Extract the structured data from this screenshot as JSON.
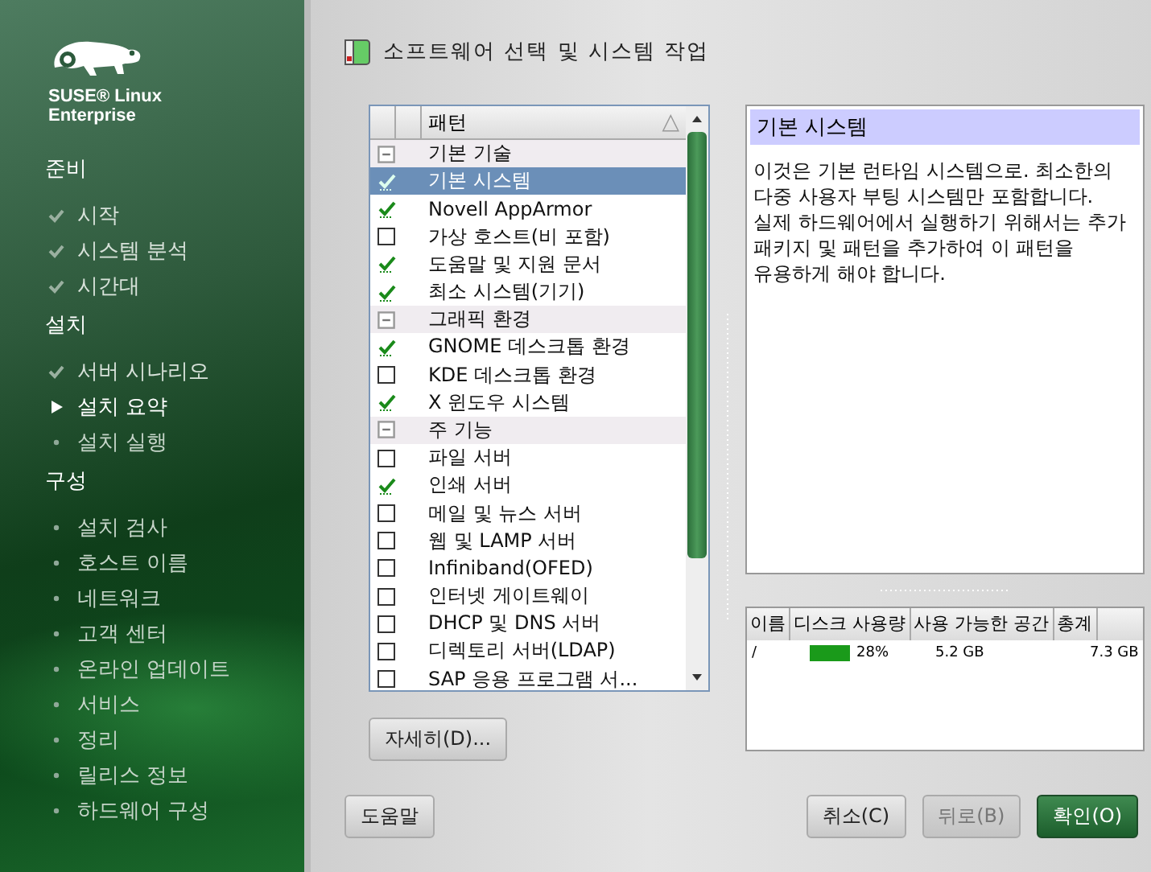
{
  "sidebar": {
    "logo_text": "SUSE® Linux Enterprise",
    "sections": [
      {
        "title": "준비",
        "items": [
          {
            "label": "시작",
            "kind": "done"
          },
          {
            "label": "시스템 분석",
            "kind": "done"
          },
          {
            "label": "시간대",
            "kind": "done"
          }
        ]
      },
      {
        "title": "설치",
        "items": [
          {
            "label": "서버 시나리오",
            "kind": "done"
          },
          {
            "label": "설치 요약",
            "kind": "current"
          },
          {
            "label": "설치 실행",
            "kind": "todo"
          }
        ]
      },
      {
        "title": "구성",
        "items": [
          {
            "label": "설치 검사",
            "kind": "todo"
          },
          {
            "label": "호스트 이름",
            "kind": "todo"
          },
          {
            "label": "네트워크",
            "kind": "todo"
          },
          {
            "label": "고객 센터",
            "kind": "todo"
          },
          {
            "label": "온라인 업데이트",
            "kind": "todo"
          },
          {
            "label": "서비스",
            "kind": "todo"
          },
          {
            "label": "정리",
            "kind": "todo"
          },
          {
            "label": "릴리스 정보",
            "kind": "todo"
          },
          {
            "label": "하드웨어 구성",
            "kind": "todo"
          }
        ]
      }
    ]
  },
  "title": "소프트웨어 선택 및 시스템 작업",
  "patterns": {
    "column": "패턴",
    "sort_glyph": "△",
    "rows": [
      {
        "kind": "group",
        "label": "기본 기술",
        "expanded": true
      },
      {
        "kind": "pattern",
        "label": "기본 시스템",
        "checked": true,
        "selected": true
      },
      {
        "kind": "pattern",
        "label": "Novell AppArmor",
        "checked": true,
        "selected": false
      },
      {
        "kind": "pattern",
        "label": "가상 호스트(비 포함)",
        "checked": false,
        "selected": false
      },
      {
        "kind": "pattern",
        "label": "도움말 및 지원 문서",
        "checked": true,
        "selected": false
      },
      {
        "kind": "pattern",
        "label": "최소 시스템(기기)",
        "checked": true,
        "selected": false
      },
      {
        "kind": "group",
        "label": "그래픽 환경",
        "expanded": true
      },
      {
        "kind": "pattern",
        "label": "GNOME 데스크톱 환경",
        "checked": true,
        "selected": false
      },
      {
        "kind": "pattern",
        "label": "KDE 데스크톱 환경",
        "checked": false,
        "selected": false
      },
      {
        "kind": "pattern",
        "label": "X 윈도우 시스템",
        "checked": true,
        "selected": false
      },
      {
        "kind": "group",
        "label": "주 기능",
        "expanded": true
      },
      {
        "kind": "pattern",
        "label": "파일 서버",
        "checked": false,
        "selected": false
      },
      {
        "kind": "pattern",
        "label": "인쇄 서버",
        "checked": true,
        "selected": false
      },
      {
        "kind": "pattern",
        "label": "메일 및 뉴스 서버",
        "checked": false,
        "selected": false
      },
      {
        "kind": "pattern",
        "label": "웹 및 LAMP 서버",
        "checked": false,
        "selected": false
      },
      {
        "kind": "pattern",
        "label": "Infiniband(OFED)",
        "checked": false,
        "selected": false
      },
      {
        "kind": "pattern",
        "label": "인터넷 게이트웨이",
        "checked": false,
        "selected": false
      },
      {
        "kind": "pattern",
        "label": "DHCP 및 DNS 서버",
        "checked": false,
        "selected": false
      },
      {
        "kind": "pattern",
        "label": "디렉토리 서버(LDAP)",
        "checked": false,
        "selected": false
      },
      {
        "kind": "pattern",
        "label": "SAP 응용 프로그램 서...",
        "checked": false,
        "selected": false
      }
    ]
  },
  "details_button": "자세히(D)...",
  "description": {
    "heading": "기본 시스템",
    "text": "이것은 기본 런타임 시스템으로. 최소한의 다중 사용자 부팅 시스템만 포함합니다. 실제 하드웨어에서 실행하기 위해서는 추가 패키지 및 패턴을 추가하여 이 패턴을 유용하게 해야 합니다."
  },
  "disk": {
    "columns": [
      "이름",
      "디스크 사용량",
      "사용 가능한 공간",
      "총계"
    ],
    "rows": [
      {
        "name": "/",
        "usage": "28%",
        "free": "5.2 GB",
        "total": "7.3 GB"
      }
    ]
  },
  "buttons": {
    "help": "도움말",
    "cancel": "취소(C)",
    "back": "뒤로(B)",
    "ok": "확인(O)"
  }
}
